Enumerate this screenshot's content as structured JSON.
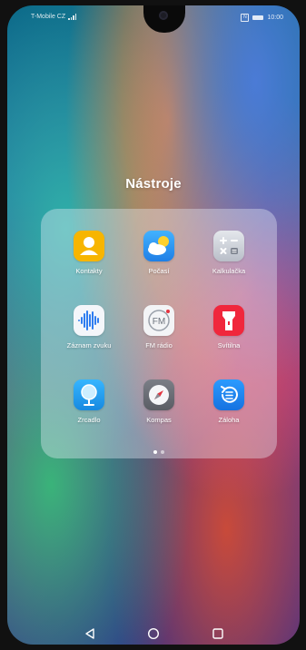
{
  "status_bar": {
    "carrier": "T-Mobile CZ",
    "signal_icon": "signal-icon",
    "nfc_icon": "nfc-icon",
    "nfc_glyph": "N",
    "battery_icon": "battery-icon",
    "time": "10:00"
  },
  "folder": {
    "title": "Nástroje",
    "apps": [
      {
        "label": "Kontakty",
        "icon": "contacts-icon",
        "color": "#f7b500"
      },
      {
        "label": "Počasí",
        "icon": "weather-icon",
        "color": "#2a8ff0"
      },
      {
        "label": "Kalkulačka",
        "icon": "calculator-icon",
        "color": "#cfd3db"
      },
      {
        "label": "Záznam zvuku",
        "icon": "sound-recorder-icon",
        "color": "#f4f6fa"
      },
      {
        "label": "FM rádio",
        "icon": "fm-radio-icon",
        "color": "#f3f4f6"
      },
      {
        "label": "Svítilna",
        "icon": "flashlight-icon",
        "color": "#f0273c"
      },
      {
        "label": "Zrcadlo",
        "icon": "mirror-icon",
        "color": "#1ea3ef"
      },
      {
        "label": "Kompas",
        "icon": "compass-icon",
        "color": "#6d7078"
      },
      {
        "label": "Záloha",
        "icon": "backup-icon",
        "color": "#1f86f0"
      }
    ],
    "pages": {
      "count": 2,
      "current": 1
    }
  },
  "navbar": {
    "back_icon": "back-triangle-icon",
    "home_icon": "home-circle-icon",
    "recents_icon": "recents-square-icon"
  }
}
